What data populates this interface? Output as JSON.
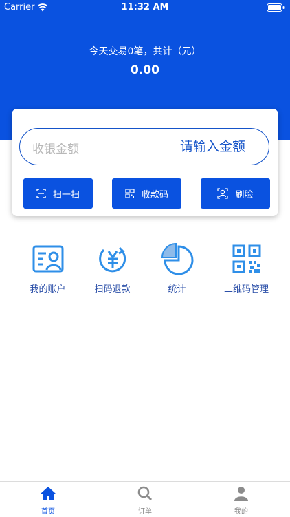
{
  "status_bar": {
    "carrier": "Carrier",
    "time": "11:32 AM"
  },
  "header": {
    "summary": "今天交易0笔，共计（元）",
    "total": "0.00",
    "color": "#0a52e0"
  },
  "amount": {
    "label": "收银金额",
    "placeholder": "请输入金额"
  },
  "actions": [
    {
      "label": "扫一扫",
      "icon": "scan-icon"
    },
    {
      "label": "收款码",
      "icon": "qr-code-icon"
    },
    {
      "label": "刷脸",
      "icon": "face-scan-icon"
    }
  ],
  "grid": [
    {
      "label": "我的账户",
      "icon": "account-card-icon"
    },
    {
      "label": "扫码退款",
      "icon": "refund-yen-icon"
    },
    {
      "label": "统计",
      "icon": "pie-chart-icon"
    },
    {
      "label": "二维码管理",
      "icon": "qr-manage-icon"
    }
  ],
  "tabs": [
    {
      "label": "首页",
      "icon": "home-icon",
      "active": true
    },
    {
      "label": "订单",
      "icon": "search-icon",
      "active": false
    },
    {
      "label": "我的",
      "icon": "person-icon",
      "active": false
    }
  ]
}
